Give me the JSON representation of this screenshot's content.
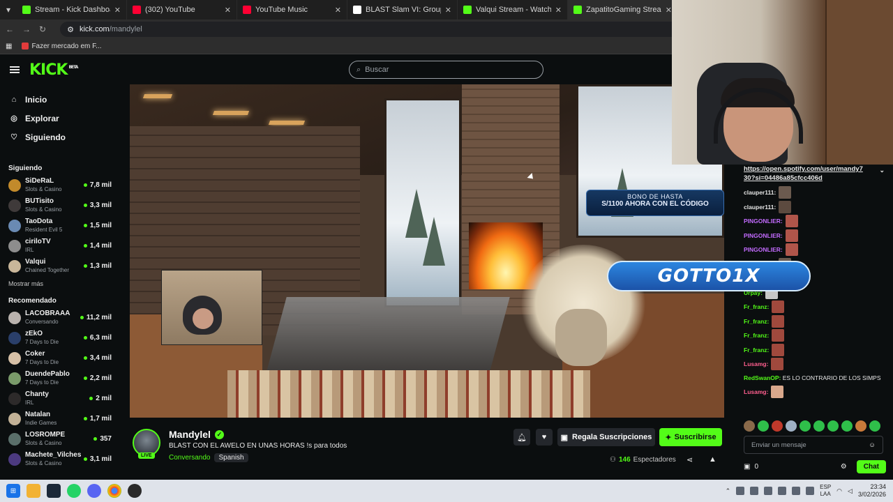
{
  "browser": {
    "tabs": [
      {
        "label": "Stream - Kick Dashboard",
        "icon": "kick-icon",
        "color": "#53fc18",
        "active": false
      },
      {
        "label": "(302) YouTube",
        "icon": "youtube-icon",
        "color": "#ff0033",
        "active": false
      },
      {
        "label": "YouTube Music",
        "icon": "youtube-music-icon",
        "color": "#ff0033",
        "active": false
      },
      {
        "label": "BLAST Slam VI: Group Stage - L",
        "icon": "blast-icon",
        "color": "#ffffff",
        "active": false
      },
      {
        "label": "Valqui Stream - Watch Live on",
        "icon": "kick-icon",
        "color": "#53fc18",
        "active": false
      },
      {
        "label": "ZapatitoGaming Stream - Watc",
        "icon": "kick-icon",
        "color": "#53fc18",
        "active": true
      }
    ],
    "address": {
      "domain": "kick.com",
      "path": "/mandylel"
    },
    "bookmark": "Fazer mercado em F..."
  },
  "kick": {
    "logo": "KICK",
    "logo_badge": "BETA",
    "accent": "#53fc18",
    "search_placeholder": "Buscar",
    "nav": [
      {
        "label": "Inicio",
        "icon": "home-icon"
      },
      {
        "label": "Explorar",
        "icon": "compass-icon"
      },
      {
        "label": "Siguiendo",
        "icon": "heart-icon"
      }
    ],
    "following_title": "Siguiendo",
    "following": [
      {
        "name": "SiDeRaL",
        "category": "Slots & Casino",
        "viewers": "7,8 mil",
        "color": "#c28a2b"
      },
      {
        "name": "BUTisito",
        "category": "Slots & Casino",
        "viewers": "3,3 mil",
        "color": "#3f3a3a"
      },
      {
        "name": "TaoDota",
        "category": "Resident Evil 5",
        "viewers": "1,5 mil",
        "color": "#6a8ab3"
      },
      {
        "name": "ciriloTV",
        "category": "IRL",
        "viewers": "1,4 mil",
        "color": "#8d8d8d"
      },
      {
        "name": "Valqui",
        "category": "Chained Together",
        "viewers": "1,3 mil",
        "color": "#c9b79a"
      }
    ],
    "show_more": "Mostrar más",
    "recommended_title": "Recomendado",
    "recommended": [
      {
        "name": "LACOBRAAA",
        "category": "Conversando",
        "viewers": "11,2 mil",
        "color": "#b9b2ad"
      },
      {
        "name": "zEkO",
        "category": "7 Days to Die",
        "viewers": "6,3 mil",
        "color": "#2a3f6a"
      },
      {
        "name": "Coker",
        "category": "7 Days to Die",
        "viewers": "3,4 mil",
        "color": "#d6c0a6"
      },
      {
        "name": "DuendePablo",
        "category": "7 Days to Die",
        "viewers": "2,2 mil",
        "color": "#7a9b6a"
      },
      {
        "name": "Chanty",
        "category": "IRL",
        "viewers": "2 mil",
        "color": "#2d2a2a"
      },
      {
        "name": "Natalan",
        "category": "Indie Games",
        "viewers": "1,7 mil",
        "color": "#c2b196"
      },
      {
        "name": "LOSROMPE",
        "category": "Slots & Casino",
        "viewers": "357",
        "color": "#5a6f6a"
      },
      {
        "name": "Machete_Vilches",
        "category": "Slots & Casino",
        "viewers": "3,1 mil",
        "color": "#4c3a80"
      }
    ]
  },
  "video": {
    "promo_line1": "BONO DE HASTA",
    "promo_line2": "S/1100 AHORA CON EL CÓDIGO"
  },
  "stream": {
    "name": "Mandylel",
    "live": "LIVE",
    "title": "BLAST CON EL AWELO EN UNAS HORAS !s para todos",
    "category": "Conversando",
    "tag": "Spanish",
    "gift_label": "Regala Suscripciones",
    "subscribe_label": "Suscribirse",
    "viewers_count": "146",
    "viewers_label": "Espectadores"
  },
  "chat": {
    "pinned": "https://open.spotify.com/user/mandy730?si=04486a85cfcc406d",
    "pinned_line1": "https://open.spotify.com/user/mandy7",
    "pinned_line2": "30?si=04486a85cfcc406d",
    "overlay": "GOTTO1X",
    "messages": [
      {
        "user": "clauper111:",
        "color": "#e6e6e6",
        "emote": "#6b5a4f",
        "text": ""
      },
      {
        "user": "clauper111:",
        "color": "#e6e6e6",
        "emote": "#5c4a3f",
        "text": ""
      },
      {
        "user": "PINGONLIER:",
        "color": "#c36bff",
        "emote": "#b0554a",
        "text": ""
      },
      {
        "user": "PINGONLIER:",
        "color": "#c36bff",
        "emote": "#b0554a",
        "text": ""
      },
      {
        "user": "PINGONLIER:",
        "color": "#c36bff",
        "emote": "#b0554a",
        "text": ""
      },
      {
        "user": "clauper111:",
        "color": "#e6e6e6",
        "emote": "#6b5a4f",
        "text": ""
      },
      {
        "user": "Fr_franz:",
        "color": "#53fc18",
        "emote": "#5a4a42",
        "text": ""
      },
      {
        "user": "Urpay:",
        "color": "#53fc18",
        "emote": "#c7c7c7",
        "text": ""
      },
      {
        "user": "Fr_franz:",
        "color": "#53fc18",
        "emote": "#a0493d",
        "text": ""
      },
      {
        "user": "Fr_franz:",
        "color": "#53fc18",
        "emote": "#a0493d",
        "text": ""
      },
      {
        "user": "Fr_franz:",
        "color": "#53fc18",
        "emote": "#a0493d",
        "text": ""
      },
      {
        "user": "Fr_franz:",
        "color": "#53fc18",
        "emote": "#a0493d",
        "text": ""
      },
      {
        "user": "Lusamg:",
        "color": "#ff5f8f",
        "emote": "#a0493d",
        "text": ""
      }
    ],
    "long_message": {
      "user": "RedSwanOP:",
      "color": "#53fc18",
      "text": "ES LO CONTRARIO DE LOS SIMPS"
    },
    "last_message": {
      "user": "Lusamg:",
      "color": "#ff5f8f",
      "emote": "#d9a88c"
    },
    "input_placeholder": "Enviar un mensaje",
    "points": "0",
    "send_label": "Chat"
  },
  "taskbar": {
    "lang_top": "ESP",
    "lang_bottom": "LAA",
    "time": "23:34",
    "date": "3/02/2026"
  }
}
